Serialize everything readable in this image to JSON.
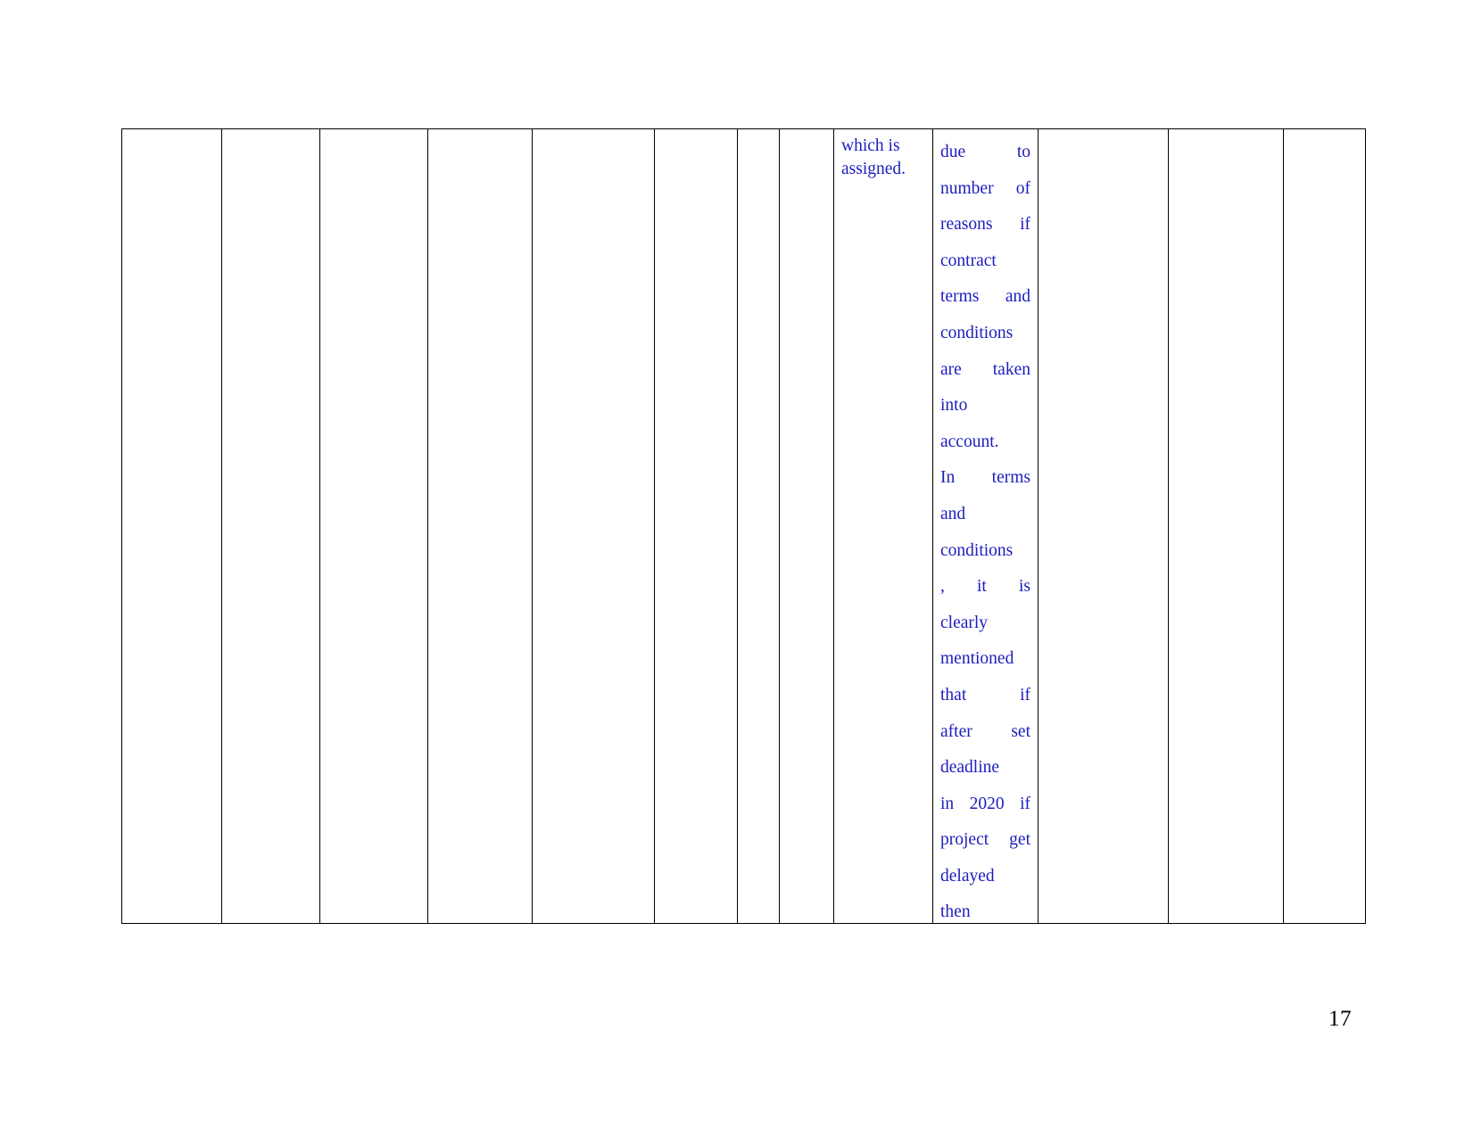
{
  "document": {
    "page_number": "17",
    "text_color": "#1d1dbd",
    "border_color": "#000000",
    "background_color": "#ffffff"
  },
  "table": {
    "columns": 13,
    "rows": 1,
    "empty_cells": [
      "",
      "",
      "",
      "",
      "",
      "",
      "",
      "",
      "",
      "",
      ""
    ],
    "cells": {
      "col9_text": "which is assigned.",
      "col10_lines": [
        "due to",
        "number of",
        "reasons if",
        "contract",
        "terms and",
        "conditions",
        "are taken",
        "into",
        "account.",
        "In terms",
        "and",
        "conditions",
        ", it is",
        "clearly",
        "mentioned",
        "that if",
        "after set",
        "deadline",
        "in 2020 if",
        "project get",
        "delayed",
        "then"
      ],
      "col10_full_text": "due to number of reasons if contract terms and conditions are taken into account. In terms and conditions , it is clearly mentioned that if after set deadline in 2020 if project get delayed then"
    }
  }
}
